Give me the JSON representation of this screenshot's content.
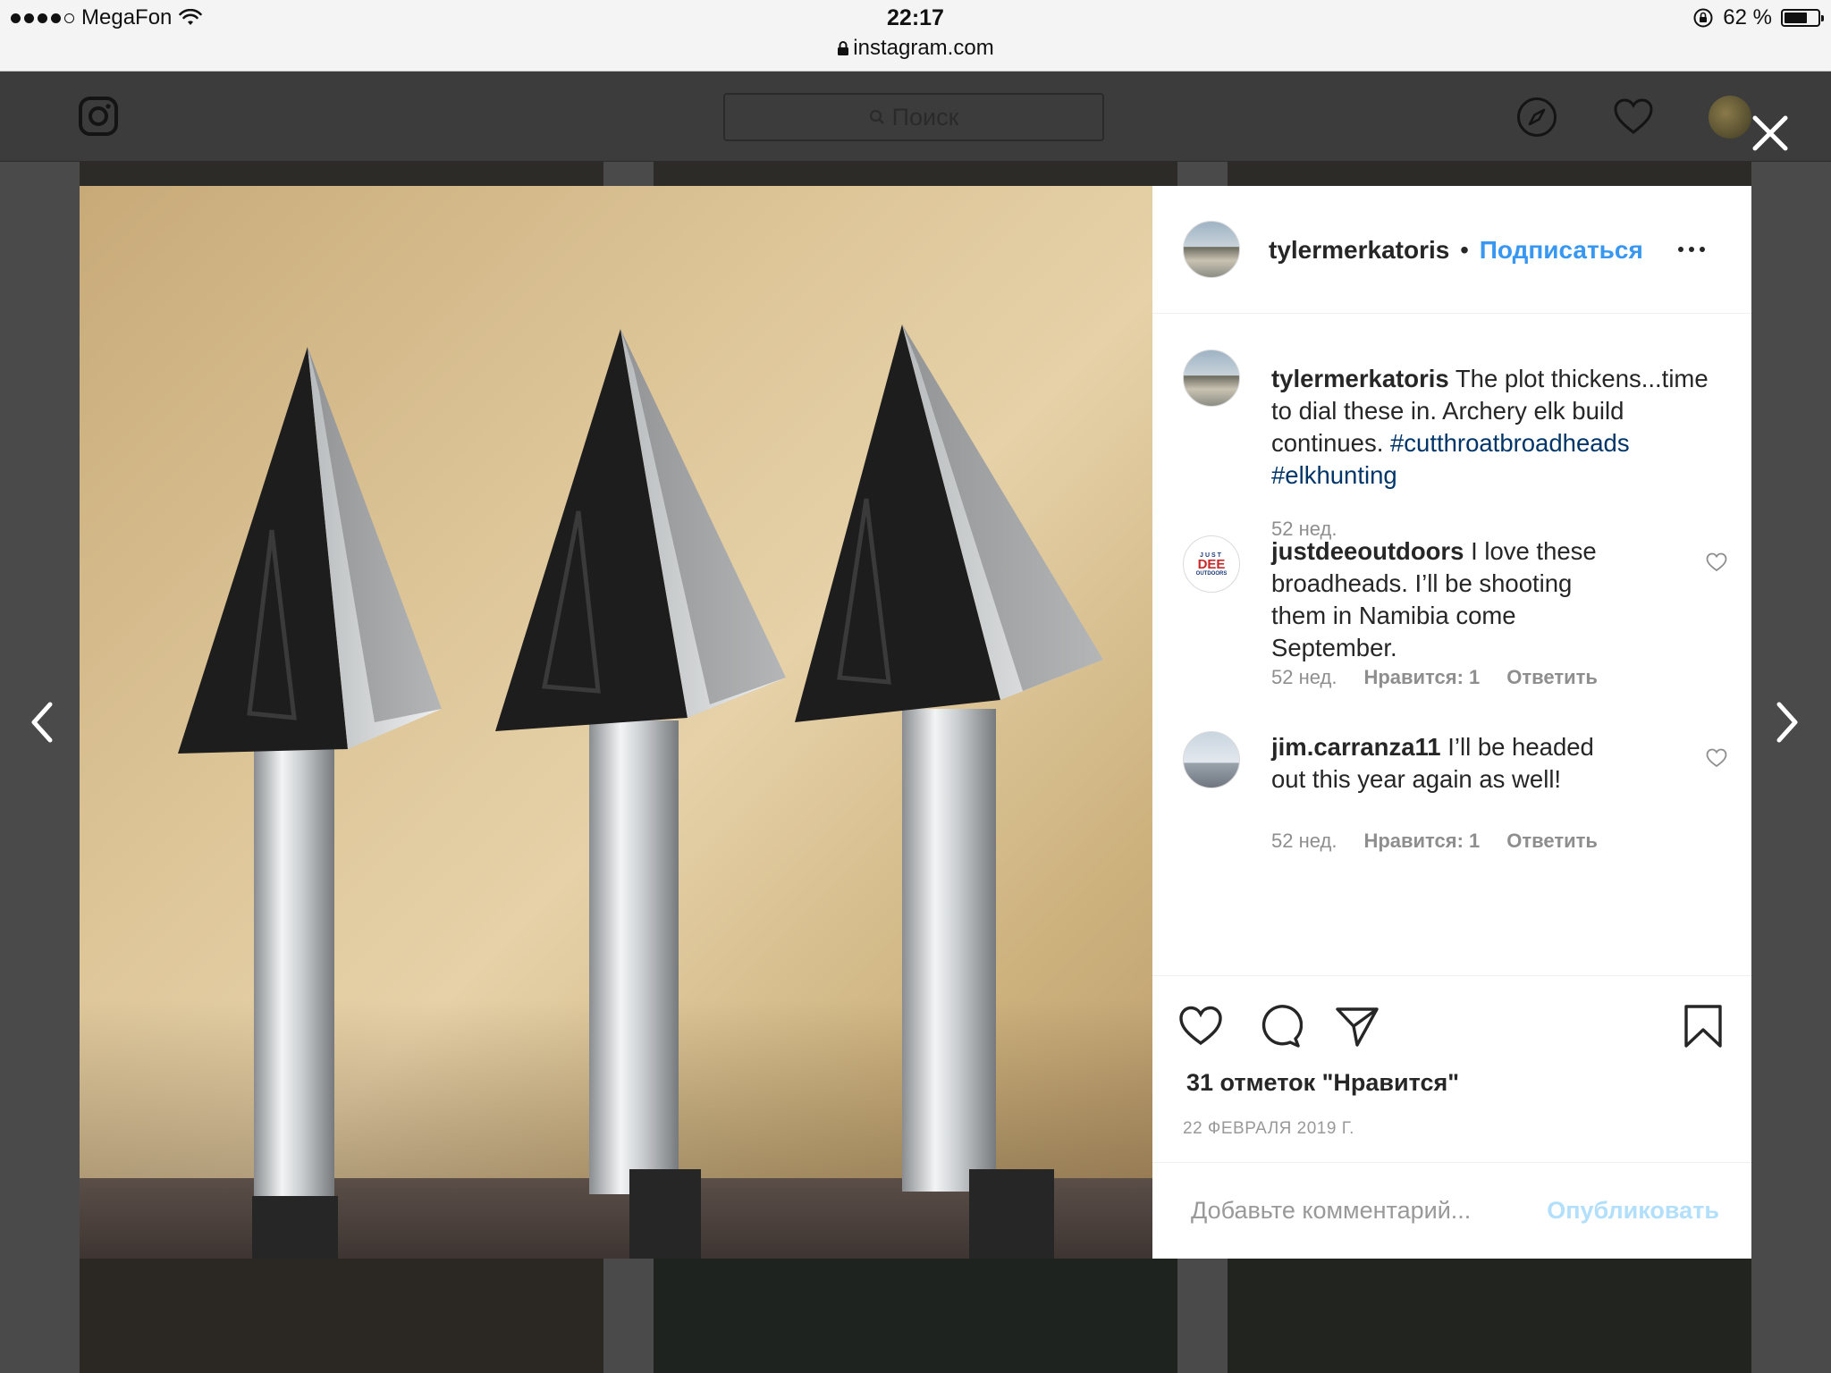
{
  "status_bar": {
    "carrier": "MegaFon",
    "time": "22:17",
    "url": "instagram.com",
    "battery": "62 %"
  },
  "header": {
    "search_placeholder": "Поиск"
  },
  "post": {
    "author": "tylermerkatoris",
    "separator": "•",
    "follow_label": "Подписаться",
    "caption": {
      "user": "tylermerkatoris",
      "text": "The plot thickens...time to dial these in. Archery elk build continues.",
      "hashtags": [
        "#cutthroatbroadheads",
        "#elkhunting"
      ],
      "age": "52 нед."
    },
    "comments": [
      {
        "user": "justdeeoutdoors",
        "text": "I love these broadheads. I’ll be shooting them in Namibia come September.",
        "age": "52 нед.",
        "likes": "Нравится: 1",
        "reply": "Ответить"
      },
      {
        "user": "jim.carranza11",
        "text": "I’ll be headed out this year again as well!",
        "age": "52 нед.",
        "likes": "Нравится: 1",
        "reply": "Ответить"
      }
    ],
    "likes_count": "31 отметок \"Нравится\"",
    "date": "22 ФЕВРАЛЯ 2019 Г.",
    "comment_placeholder": "Добавьте комментарий...",
    "publish_label": "Опубликовать",
    "dee_logo": {
      "line1": "JUST",
      "line2": "DEE",
      "line3": "OUTDOORS"
    }
  },
  "colors": {
    "link_blue": "#3897f0",
    "hashtag_blue": "#003569",
    "publish_disabled": "#b2dffc",
    "meta_gray": "#8e8e8e"
  }
}
